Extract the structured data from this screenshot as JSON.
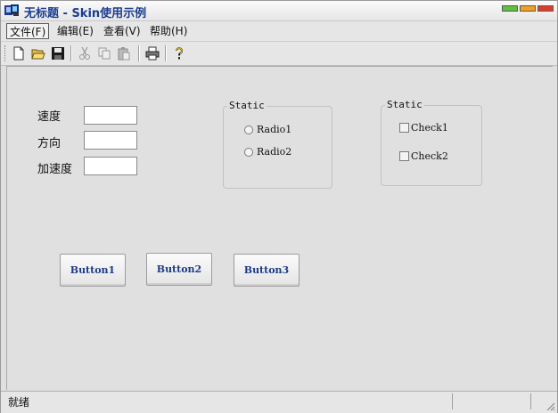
{
  "window": {
    "title": "无标题 - Skin使用示例"
  },
  "menu": {
    "items": [
      {
        "label": "文件(F)"
      },
      {
        "label": "编辑(E)"
      },
      {
        "label": "查看(V)"
      },
      {
        "label": "帮助(H)"
      }
    ]
  },
  "toolbar": {
    "icons": [
      "new-file-icon",
      "open-folder-icon",
      "save-icon",
      "cut-icon",
      "copy-icon",
      "paste-icon",
      "print-icon",
      "help-icon"
    ]
  },
  "form": {
    "labels": [
      "速度",
      "方向",
      "加速度"
    ],
    "values": [
      "",
      "",
      ""
    ]
  },
  "radio_group": {
    "title": "Static",
    "options": [
      "Radio1",
      "Radio2"
    ]
  },
  "check_group": {
    "title": "Static",
    "options": [
      "Check1",
      "Check2"
    ]
  },
  "buttons": [
    "Button1",
    "Button2",
    "Button3"
  ],
  "status": {
    "text": "就绪"
  },
  "colors": {
    "title_text": "#1b3d8f",
    "button_text": "#1c3a86",
    "window_btn_1": "#5fbf3f",
    "window_btn_2": "#f0a020",
    "window_btn_3": "#e03a2a"
  }
}
